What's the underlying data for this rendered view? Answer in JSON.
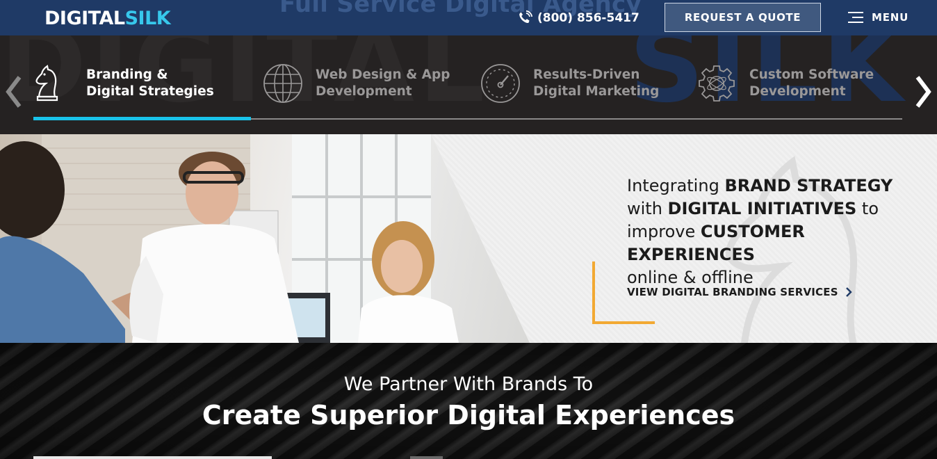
{
  "header": {
    "background_title": "Full Service Digital Agency",
    "logo": {
      "part1": "DIGITAL",
      "part2": "SILK"
    },
    "phone": "(800) 856-5417",
    "phone_icon": "phone-icon",
    "quote_label": "REQUEST A QUOTE",
    "menu_label": "MENU",
    "menu_icon": "hamburger-icon"
  },
  "services": {
    "tabs": [
      {
        "line1": "Branding &",
        "line2": "Digital Strategies",
        "icon": "knight-chess-icon",
        "active": true
      },
      {
        "line1": "Web Design & App",
        "line2": "Development",
        "icon": "globe-icon",
        "active": false
      },
      {
        "line1": "Results-Driven",
        "line2": "Digital Marketing",
        "icon": "gauge-icon",
        "active": false
      },
      {
        "line1": "Custom Software",
        "line2": "Development",
        "icon": "gear-icon",
        "active": false
      }
    ],
    "prev_icon": "chevron-left-icon",
    "next_icon": "chevron-right-icon"
  },
  "hero": {
    "headline": {
      "l1_pre": "Integrating ",
      "l1_bold": "BRAND STRATEGY",
      "l2_pre": "with ",
      "l2_bold": "DIGITAL INITIATIVES",
      "l2_post": " to",
      "l3_pre": "improve ",
      "l3_bold": "CUSTOMER EXPERIENCES",
      "l4": "online & offline"
    },
    "link_label": "VIEW DIGITAL BRANDING SERVICES",
    "link_icon": "chevron-right-icon"
  },
  "partner": {
    "subtitle": "We Partner With Brands To",
    "title": "Create Superior Digital Experiences"
  },
  "colors": {
    "header_bg": "#1f3a66",
    "accent_cyan": "#19c3ea",
    "accent_orange": "#f2a933",
    "dark_bg": "#252222"
  }
}
